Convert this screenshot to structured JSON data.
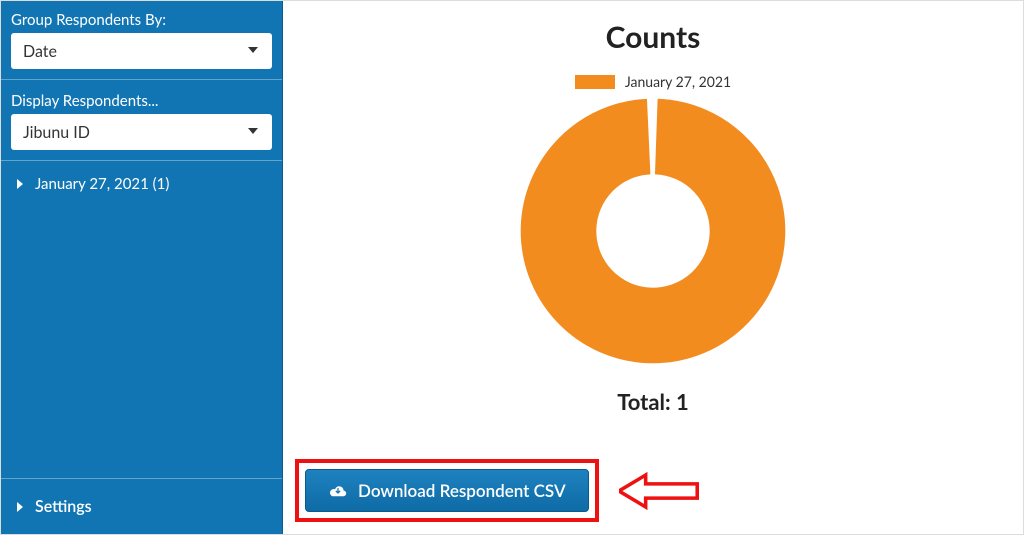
{
  "sidebar": {
    "group_label": "Group Respondents By:",
    "group_value": "Date",
    "display_label": "Display Respondents...",
    "display_value": "Jibunu ID",
    "items": [
      {
        "label": "January 27, 2021 (1)"
      }
    ],
    "settings_label": "Settings"
  },
  "main": {
    "title": "Counts",
    "legend_label": "January 27, 2021",
    "total_label": "Total: 1",
    "download_label": "Download Respondent CSV"
  },
  "colors": {
    "accent_orange": "#f28c1f",
    "sidebar_blue": "#1275b3",
    "annotation_red": "#e11"
  },
  "chart_data": {
    "type": "pie",
    "title": "Counts",
    "categories": [
      "January 27, 2021"
    ],
    "values": [
      1
    ],
    "donut": true,
    "colors": [
      "#f28c1f"
    ],
    "legend_position": "top",
    "total": 1
  }
}
